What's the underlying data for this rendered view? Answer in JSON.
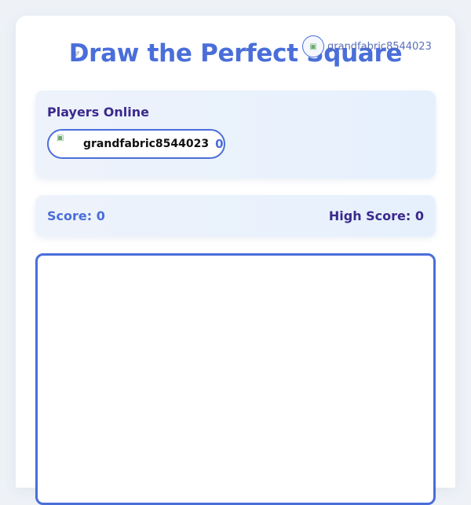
{
  "header": {
    "title": "Draw the Perfect Square",
    "logo_icon": "broken-image-icon",
    "current_user": {
      "name": "grandfabric8544023",
      "avatar_icon": "user-avatar-icon"
    }
  },
  "players": {
    "title": "Players Online",
    "list": [
      {
        "name": "grandfabric8544023",
        "score": "0",
        "avatar_icon": "broken-image-icon"
      }
    ]
  },
  "scoreboard": {
    "score_label": "Score: 0",
    "high_score_label": "High Score: 0"
  },
  "colors": {
    "accent": "#4a6ed9",
    "dark_accent": "#3a2a8c",
    "panel_bg": "#eef3fb"
  }
}
